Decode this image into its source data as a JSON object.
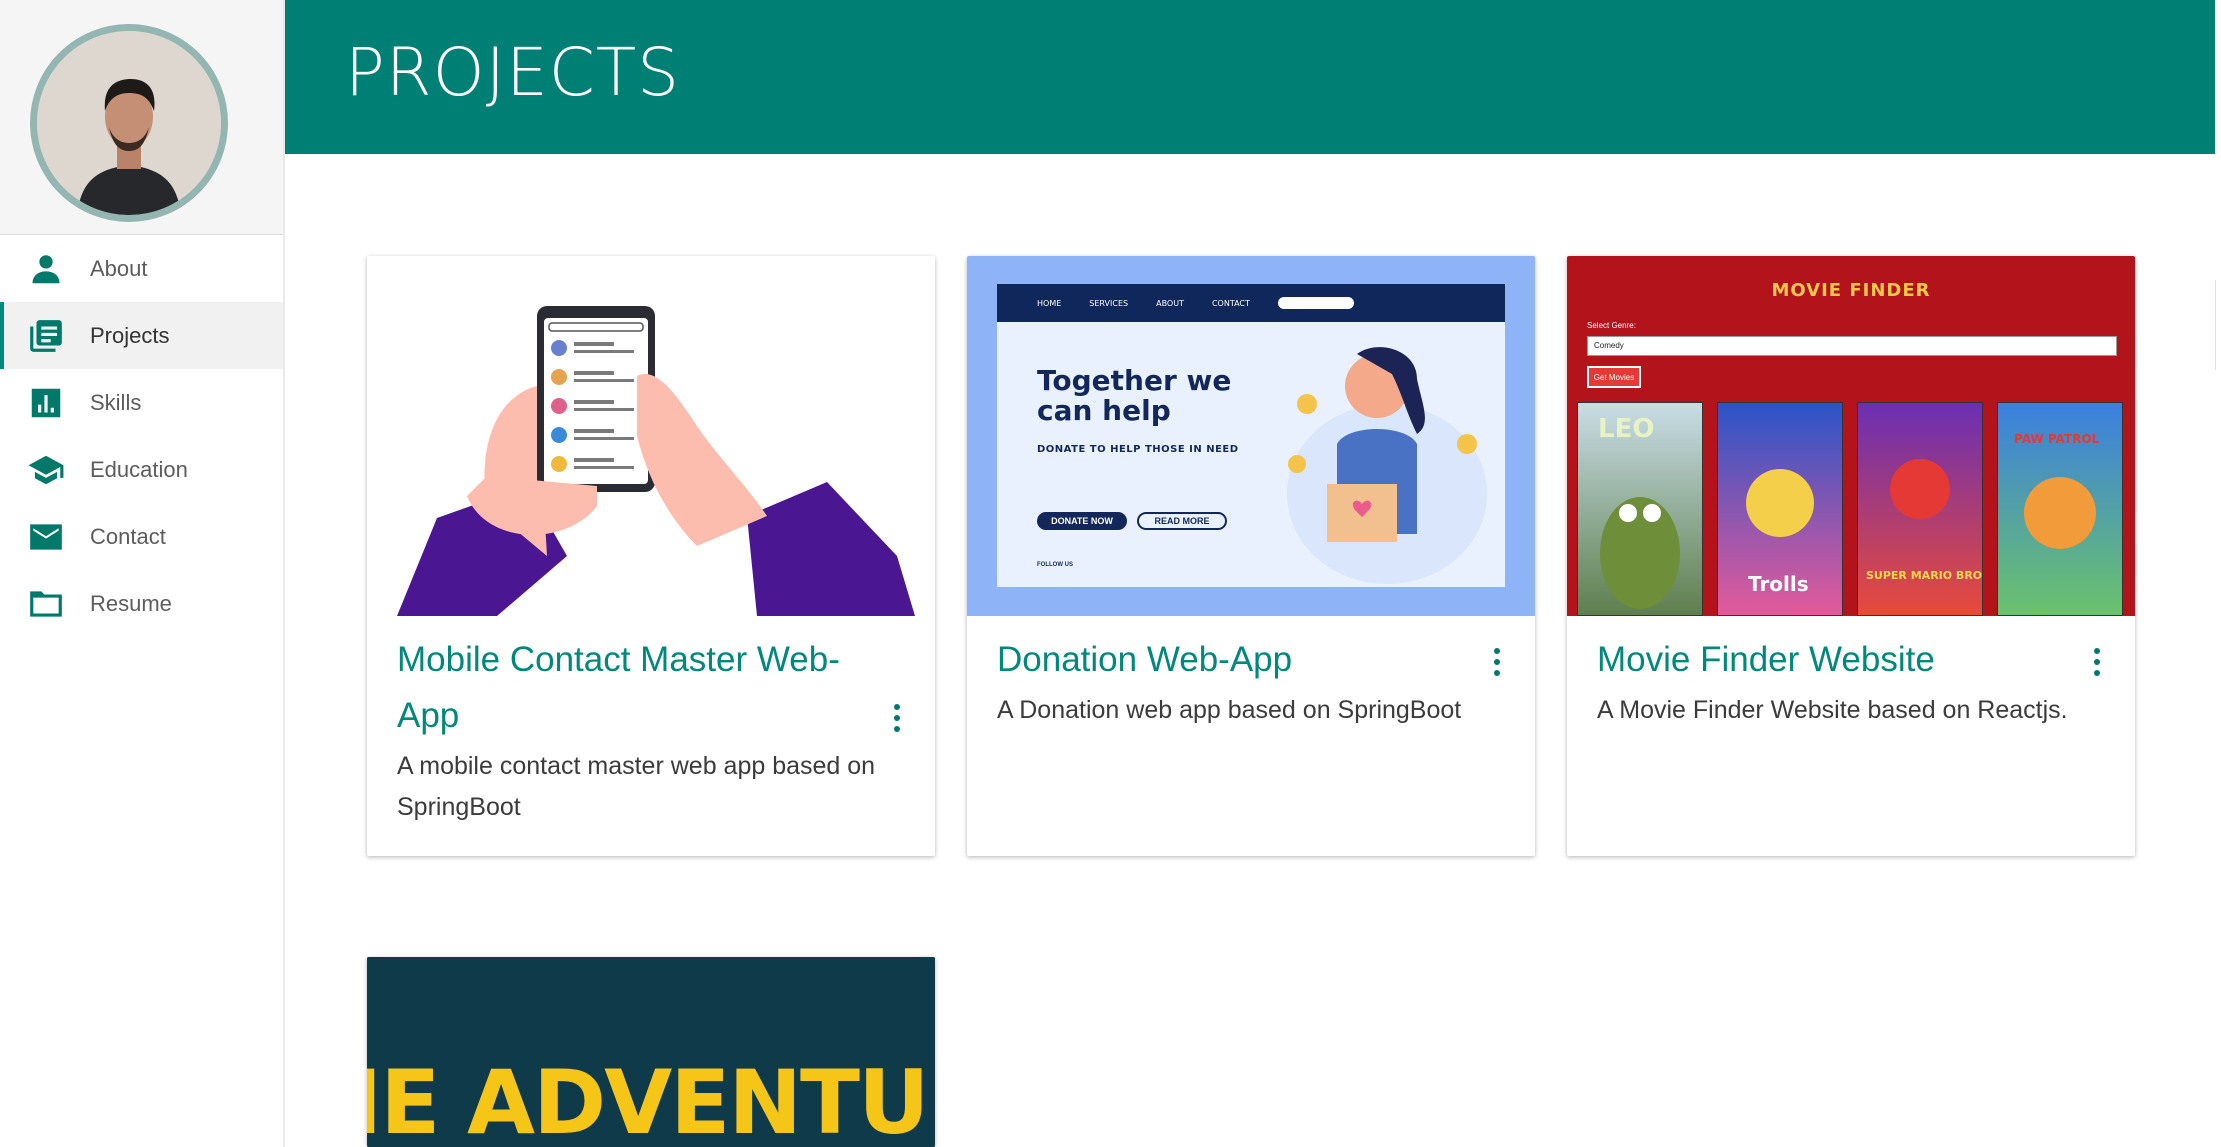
{
  "sidebar": {
    "items": [
      {
        "label": "About",
        "icon": "person-icon"
      },
      {
        "label": "Projects",
        "icon": "projects-icon"
      },
      {
        "label": "Skills",
        "icon": "bar-chart-icon"
      },
      {
        "label": "Education",
        "icon": "graduation-cap-icon"
      },
      {
        "label": "Contact",
        "icon": "mail-icon"
      },
      {
        "label": "Resume",
        "icon": "folder-icon"
      }
    ],
    "active": "Projects"
  },
  "header": {
    "title": "PROJECTS"
  },
  "colors": {
    "accent": "#00897b",
    "header_bg": "#008075"
  },
  "projects": [
    {
      "title": "Mobile Contact Master Web-App",
      "description": "A mobile contact master web app based on SpringBoot"
    },
    {
      "title": "Donation Web-App",
      "description": "A Donation web app based on SpringBoot",
      "image_text": {
        "nav": [
          "HOME",
          "SERVICES",
          "ABOUT",
          "CONTACT"
        ],
        "headline": "Together we can help",
        "subheadline": "DONATE TO HELP THOSE IN NEED",
        "primary_button": "DONATE NOW",
        "secondary_button": "READ MORE",
        "follow": "FOLLOW US"
      }
    },
    {
      "title": "Movie Finder Website",
      "description": "A Movie Finder Website based on Reactjs.",
      "image_text": {
        "heading": "MOVIE FINDER",
        "genre_label": "Select Genre:",
        "genre_value": "Comedy",
        "button": "Get Movies",
        "posters": [
          "LEO",
          "Trolls",
          "SUPER MARIO BROS",
          "PAW PATROL"
        ]
      }
    },
    {
      "image_text": {
        "heading": "THE ADVENTURE"
      }
    }
  ]
}
